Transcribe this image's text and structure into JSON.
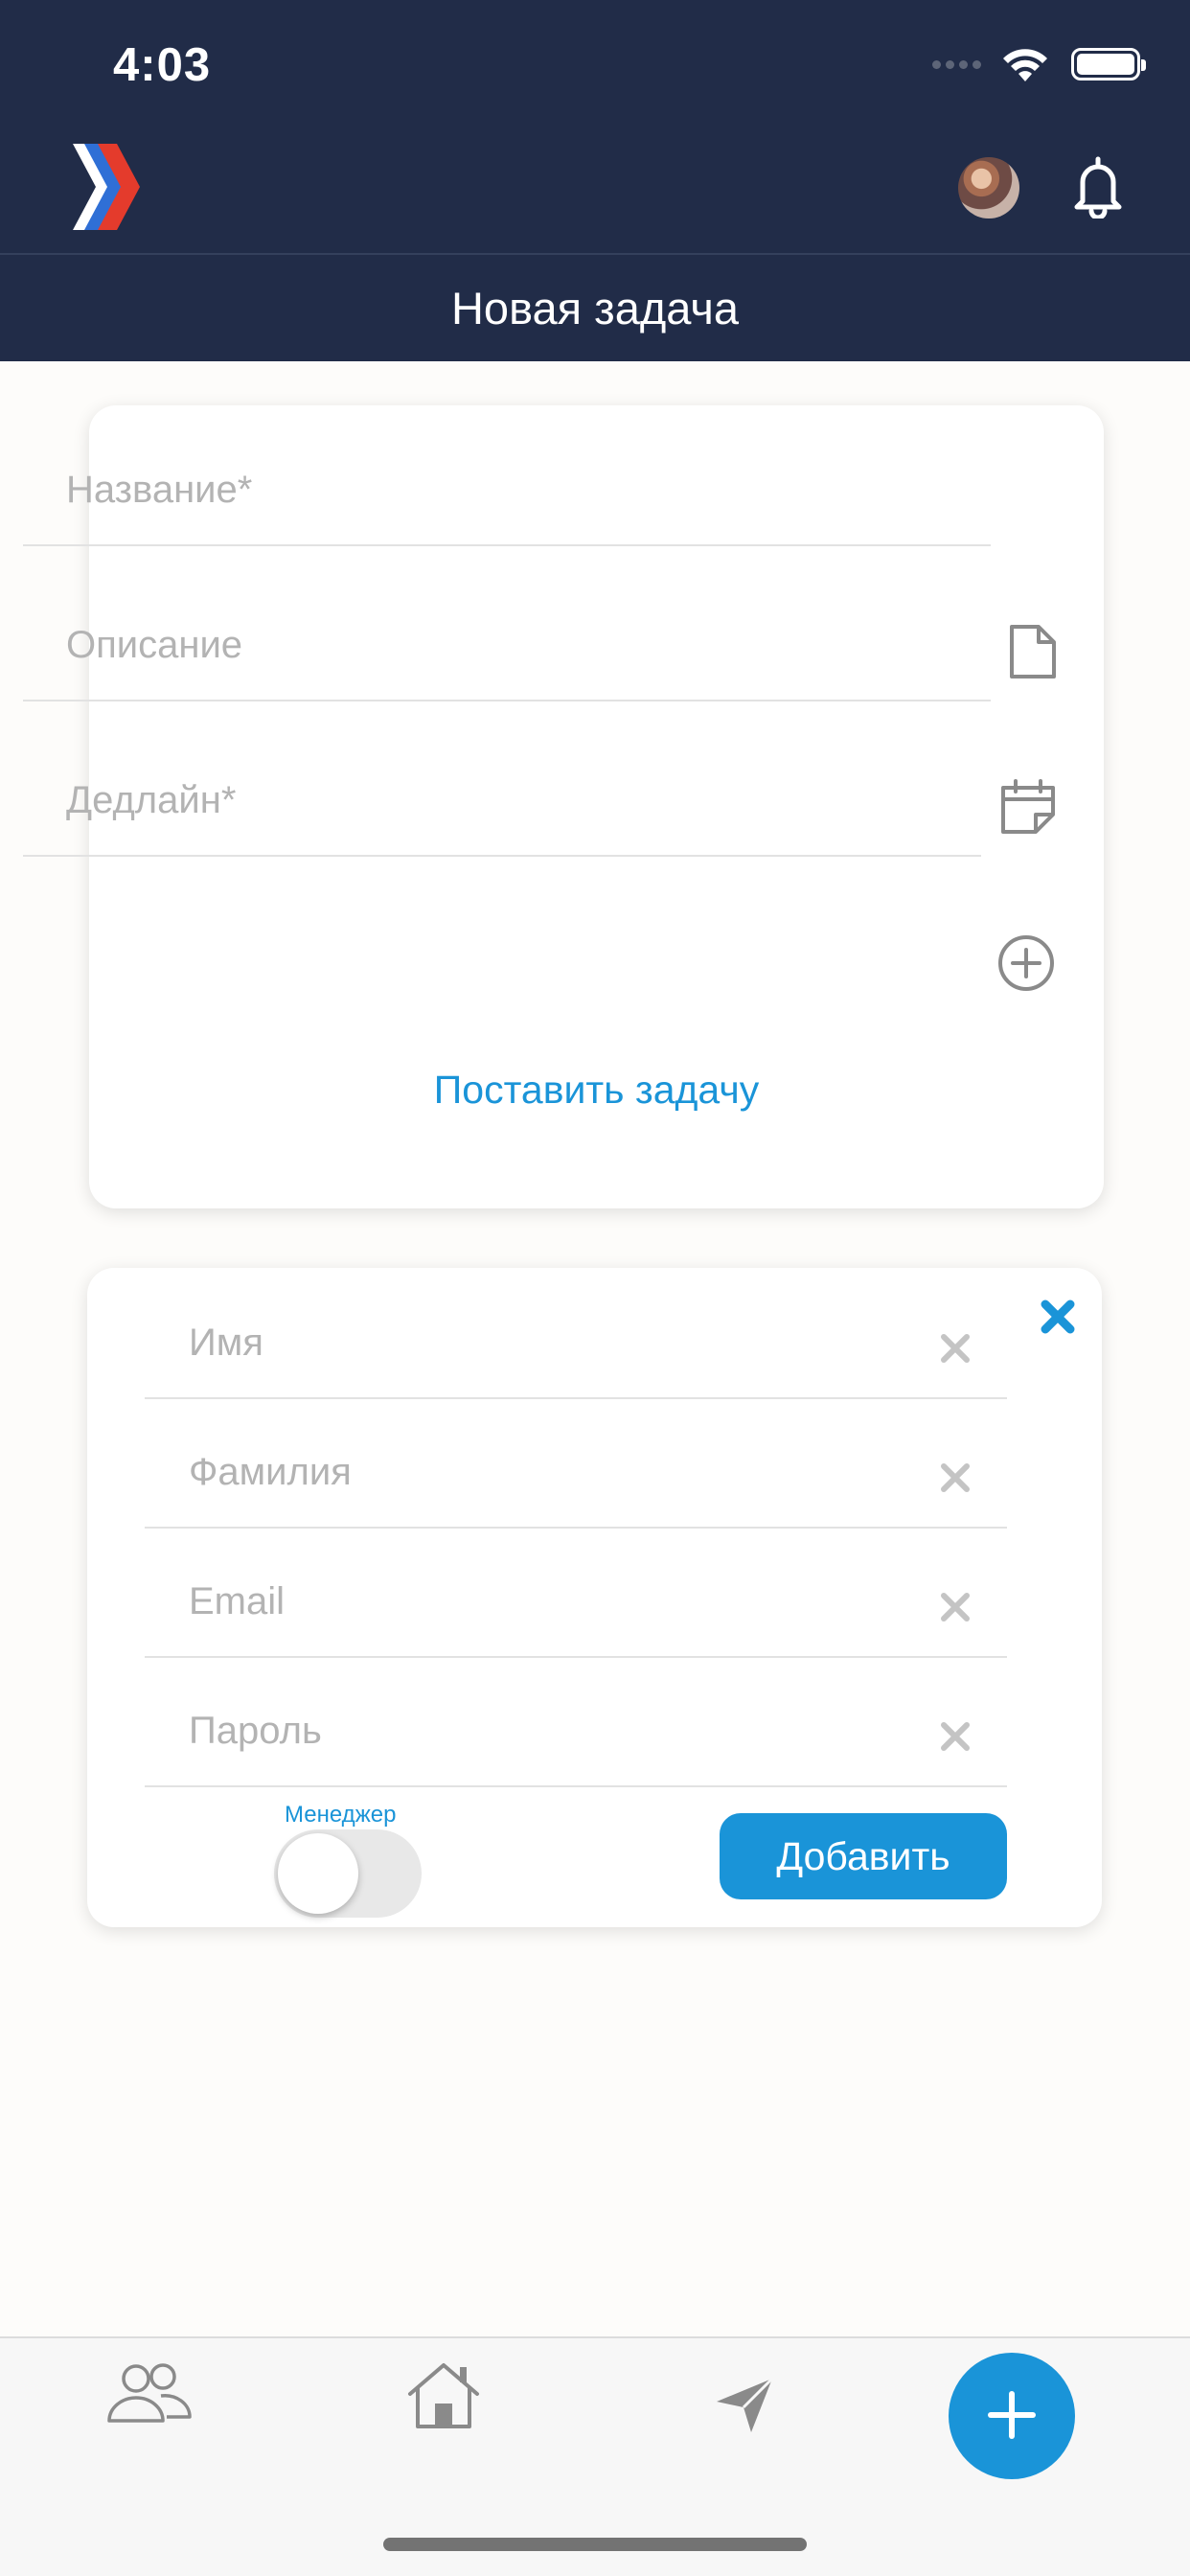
{
  "status_bar": {
    "time": "4:03"
  },
  "header": {
    "logo_icon": "chevron-logo-icon",
    "avatar_icon": "user-avatar",
    "bell_icon": "bell-icon",
    "title": "Новая задача"
  },
  "task_form": {
    "name_placeholder": "Название*",
    "description_placeholder": "Описание",
    "description_icon": "document-icon",
    "deadline_placeholder": "Дедлайн*",
    "deadline_icon": "calendar-icon",
    "add_icon": "plus-circle-icon",
    "submit_label": "Поставить задачу"
  },
  "user_form": {
    "close_icon": "close-icon",
    "first_name_placeholder": "Имя",
    "last_name_placeholder": "Фамилия",
    "email_placeholder": "Email",
    "password_placeholder": "Пароль",
    "clear_icon": "clear-x-icon",
    "manager_label": "Менеджер",
    "manager_toggle_on": false,
    "add_button_label": "Добавить"
  },
  "tab_bar": {
    "items": [
      "people-icon",
      "home-icon",
      "send-icon"
    ],
    "fab_icon": "plus-icon"
  },
  "colors": {
    "header_bg": "#212c48",
    "accent": "#1a94d8",
    "page_bg": "#fdfcfa",
    "placeholder": "#b3b3b3"
  }
}
